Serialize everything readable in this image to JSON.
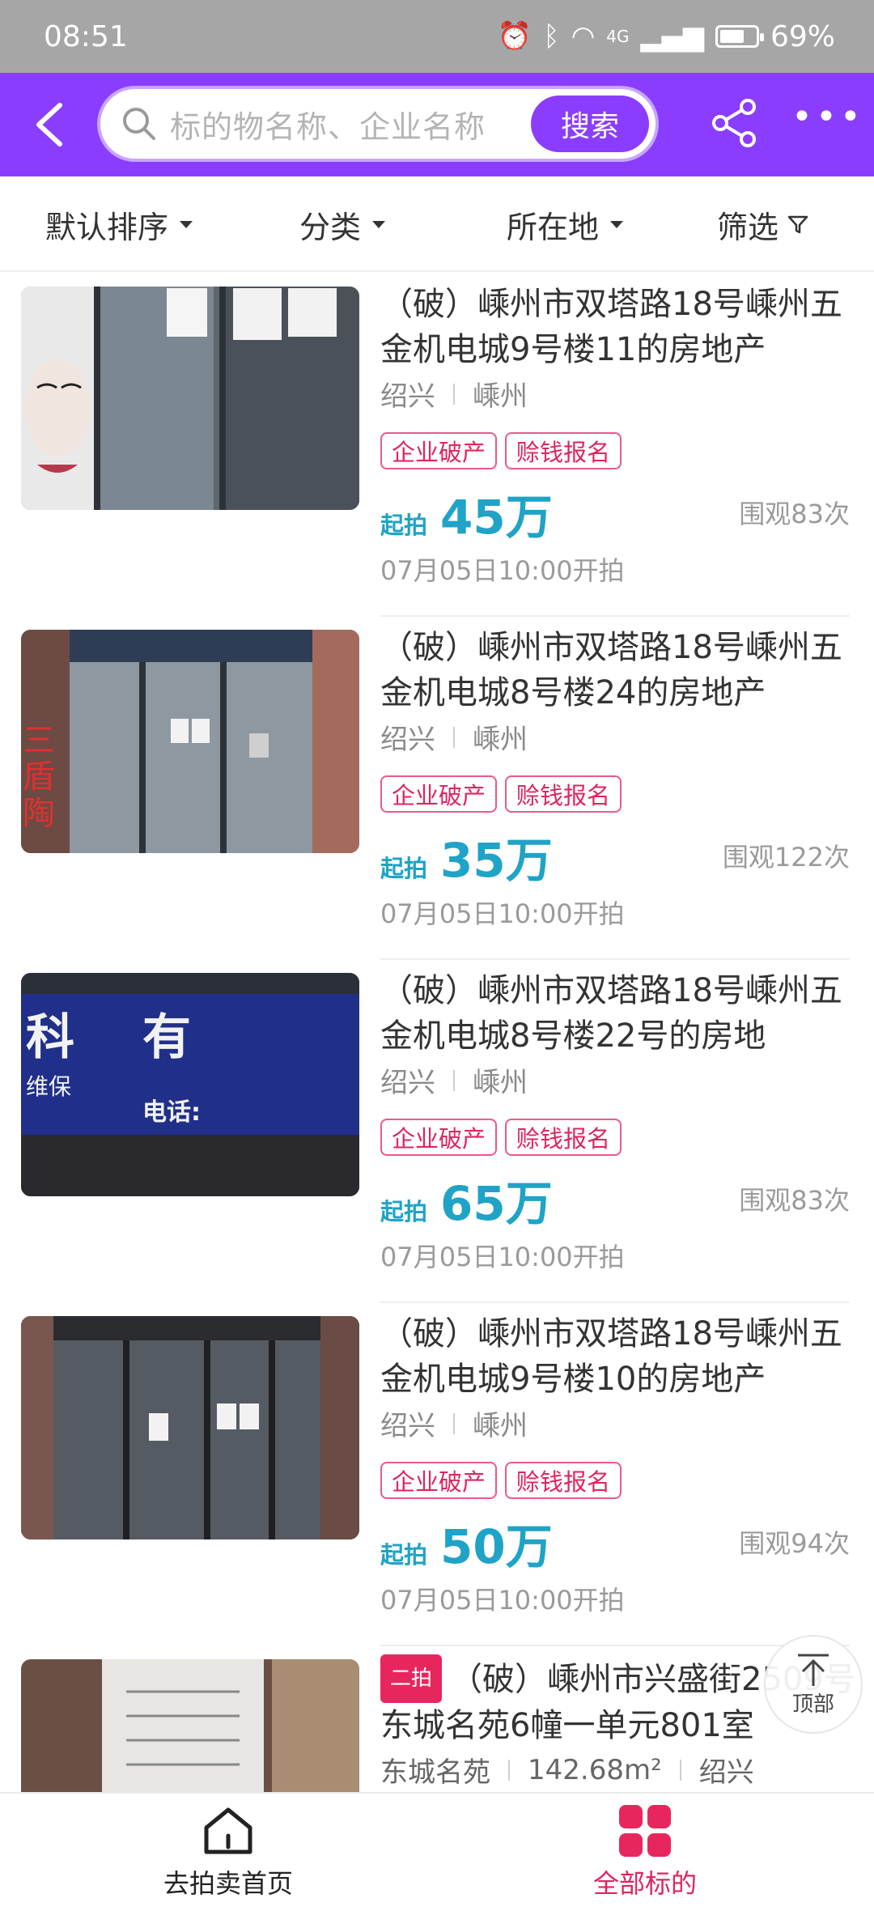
{
  "status_bar": {
    "time": "08:51",
    "battery_level": 0.69,
    "battery_text": "69%",
    "network": "4G"
  },
  "header": {
    "search_placeholder": "标的物名称、企业名称",
    "search_button": "搜索"
  },
  "filters": [
    {
      "label": "默认排序"
    },
    {
      "label": "分类"
    },
    {
      "label": "所在地"
    },
    {
      "label": "筛选"
    }
  ],
  "items": [
    {
      "title": "（破）嵊州市双塔路18号嵊州五金机电城9号楼11的房地产",
      "city": "绍兴",
      "district": "嵊州",
      "tags": [
        "企业破产",
        "赊钱报名"
      ],
      "start_label": "起拍",
      "price": "45万",
      "views": "围观83次",
      "time": "07月05日10:00开拍"
    },
    {
      "title": "（破）嵊州市双塔路18号嵊州五金机电城8号楼24的房地产",
      "city": "绍兴",
      "district": "嵊州",
      "tags": [
        "企业破产",
        "赊钱报名"
      ],
      "start_label": "起拍",
      "price": "35万",
      "views": "围观122次",
      "time": "07月05日10:00开拍"
    },
    {
      "title": "（破）嵊州市双塔路18号嵊州五金机电城8号楼22号的房地",
      "city": "绍兴",
      "district": "嵊州",
      "tags": [
        "企业破产",
        "赊钱报名"
      ],
      "start_label": "起拍",
      "price": "65万",
      "views": "围观83次",
      "time": "07月05日10:00开拍"
    },
    {
      "title": "（破）嵊州市双塔路18号嵊州五金机电城9号楼10的房地产",
      "city": "绍兴",
      "district": "嵊州",
      "tags": [
        "企业破产",
        "赊钱报名"
      ],
      "start_label": "起拍",
      "price": "50万",
      "views": "围观94次",
      "time": "07月05日10:00开拍"
    }
  ],
  "item5": {
    "badge": "二拍",
    "title": "（破）嵊州市兴盛街2509号东城名苑6幢一单元801室",
    "community": "东城名苑",
    "area": "142.68m²",
    "city": "绍兴"
  },
  "to_top": {
    "label": "顶部"
  },
  "bottom_tabs": {
    "home": "去拍卖首页",
    "all": "全部标的"
  }
}
